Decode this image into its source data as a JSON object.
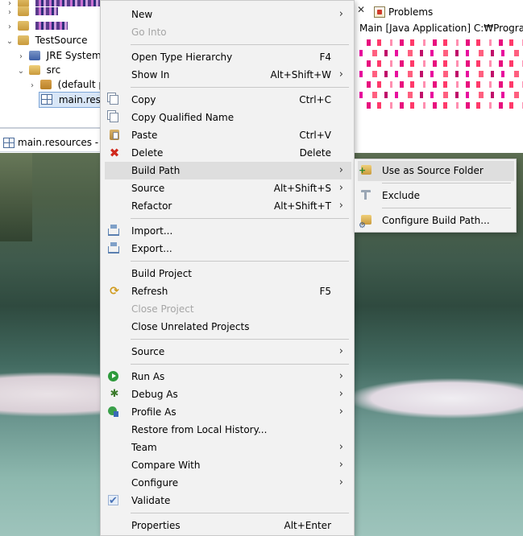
{
  "tree": {
    "project_name": "TestSource",
    "jre_label": "JRE System L",
    "src_label": "src",
    "default_package_label": "(default pa",
    "selected_label": "main.reso"
  },
  "problems_panel": {
    "tab_title": "Problems",
    "console_header": "Main [Java Application] C:₩Program F"
  },
  "editor": {
    "tab_title": "main.resources - Te"
  },
  "context_menu": {
    "items": [
      {
        "label": "New",
        "accel": "",
        "submenu": true,
        "enabled": true
      },
      {
        "label": "Go Into",
        "accel": "",
        "submenu": false,
        "enabled": false
      },
      {
        "label": "Open Type Hierarchy",
        "accel": "F4",
        "submenu": false,
        "enabled": true
      },
      {
        "label": "Show In",
        "accel": "Alt+Shift+W",
        "submenu": true,
        "enabled": true
      },
      {
        "label": "Copy",
        "accel": "Ctrl+C",
        "submenu": false,
        "enabled": true,
        "icon": "copy-icon"
      },
      {
        "label": "Copy Qualified Name",
        "accel": "",
        "submenu": false,
        "enabled": true,
        "icon": "copy-icon"
      },
      {
        "label": "Paste",
        "accel": "Ctrl+V",
        "submenu": false,
        "enabled": true,
        "icon": "paste-icon"
      },
      {
        "label": "Delete",
        "accel": "Delete",
        "submenu": false,
        "enabled": true,
        "icon": "delete-icon"
      },
      {
        "label": "Build Path",
        "accel": "",
        "submenu": true,
        "enabled": true
      },
      {
        "label": "Source",
        "accel": "Alt+Shift+S",
        "submenu": true,
        "enabled": true
      },
      {
        "label": "Refactor",
        "accel": "Alt+Shift+T",
        "submenu": true,
        "enabled": true
      },
      {
        "label": "Import...",
        "accel": "",
        "submenu": false,
        "enabled": true,
        "icon": "import-icon"
      },
      {
        "label": "Export...",
        "accel": "",
        "submenu": false,
        "enabled": true,
        "icon": "export-icon"
      },
      {
        "label": "Build Project",
        "accel": "",
        "submenu": false,
        "enabled": true
      },
      {
        "label": "Refresh",
        "accel": "F5",
        "submenu": false,
        "enabled": true,
        "icon": "refresh-icon"
      },
      {
        "label": "Close Project",
        "accel": "",
        "submenu": false,
        "enabled": false
      },
      {
        "label": "Close Unrelated Projects",
        "accel": "",
        "submenu": false,
        "enabled": true
      },
      {
        "label": "Source",
        "accel": "",
        "submenu": true,
        "enabled": true
      },
      {
        "label": "Run As",
        "accel": "",
        "submenu": true,
        "enabled": true,
        "icon": "run-icon"
      },
      {
        "label": "Debug As",
        "accel": "",
        "submenu": true,
        "enabled": true,
        "icon": "debug-icon"
      },
      {
        "label": "Profile As",
        "accel": "",
        "submenu": true,
        "enabled": true,
        "icon": "profile-icon"
      },
      {
        "label": "Restore from Local History...",
        "accel": "",
        "submenu": false,
        "enabled": true
      },
      {
        "label": "Team",
        "accel": "",
        "submenu": true,
        "enabled": true
      },
      {
        "label": "Compare With",
        "accel": "",
        "submenu": true,
        "enabled": true
      },
      {
        "label": "Configure",
        "accel": "",
        "submenu": true,
        "enabled": true
      },
      {
        "label": "Validate",
        "accel": "",
        "submenu": false,
        "enabled": true,
        "icon": "checkbox-icon"
      },
      {
        "label": "Properties",
        "accel": "Alt+Enter",
        "submenu": false,
        "enabled": true
      }
    ]
  },
  "build_path_submenu": {
    "items": [
      {
        "label": "Use as Source Folder",
        "icon": "use-as-source-folder-icon"
      },
      {
        "label": "Exclude",
        "icon": "exclude-icon"
      },
      {
        "label": "Configure Build Path...",
        "icon": "configure-build-path-icon"
      }
    ]
  }
}
